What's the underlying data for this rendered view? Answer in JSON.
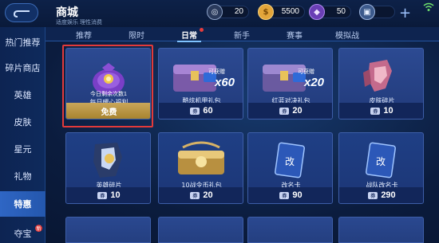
{
  "header": {
    "title": "商城",
    "subtitle": "适度娱乐 理性消费",
    "currencies": [
      {
        "icon": "token-icon",
        "value": "20"
      },
      {
        "icon": "gold-coin-icon",
        "value": "5500"
      },
      {
        "icon": "diamond-icon",
        "value": "50"
      }
    ]
  },
  "sidebar": {
    "items": [
      {
        "label": "热门推荐"
      },
      {
        "label": "碎片商店"
      },
      {
        "label": "英雄"
      },
      {
        "label": "皮肤"
      },
      {
        "label": "星元"
      },
      {
        "label": "礼物"
      },
      {
        "label": "特惠"
      },
      {
        "label": "夺宝"
      }
    ]
  },
  "tabs": [
    {
      "label": "推荐"
    },
    {
      "label": "限时"
    },
    {
      "label": "日常"
    },
    {
      "label": "新手"
    },
    {
      "label": "赛事"
    },
    {
      "label": "模拟战"
    }
  ],
  "cards": [
    {
      "label": "每日暖心福利",
      "price": "免费",
      "badge": "今日剩余次数1"
    },
    {
      "label": "酷炫机甲礼包",
      "price": "60",
      "badge": "可获赠",
      "mult": "x60"
    },
    {
      "label": "红蓝对决礼包",
      "price": "20",
      "badge": "可获赠",
      "mult": "x20"
    },
    {
      "label": "皮肤碎片",
      "price": "10"
    },
    {
      "label": "英雄碎片",
      "price": "10"
    },
    {
      "label": "10战令币礼包",
      "price": "20"
    },
    {
      "label": "改名卡",
      "price": "90",
      "card_text": "改"
    },
    {
      "label": "战队改名卡",
      "price": "290",
      "card_text": "改"
    }
  ],
  "colors": {
    "accent": "#7fc3ff",
    "free_bar": "#c9a65a",
    "highlight": "#e23a3a",
    "sidebar_active": "#2f66c4"
  }
}
